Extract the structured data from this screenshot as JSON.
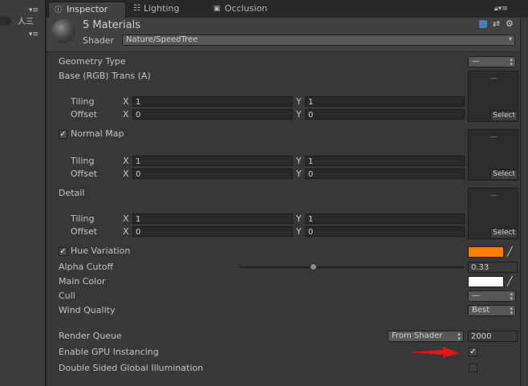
{
  "tabs": [
    {
      "label": "Inspector",
      "icon": "info-icon"
    },
    {
      "label": "Lighting",
      "icon": "lighting-icon"
    },
    {
      "label": "Occlusion",
      "icon": "occlusion-icon"
    }
  ],
  "header": {
    "title": "5 Materials",
    "shader_label": "Shader",
    "shader_value": "Nature/SpeedTree"
  },
  "properties": {
    "geometry_type": {
      "label": "Geometry Type",
      "value": "—"
    },
    "base": {
      "label": "Base (RGB) Trans (A)",
      "tiling": {
        "x": "1",
        "y": "1"
      },
      "offset": {
        "x": "0",
        "y": "0"
      }
    },
    "normal_map": {
      "label": "Normal Map",
      "checked": true,
      "tiling": {
        "x": "1",
        "y": "1"
      },
      "offset": {
        "x": "0",
        "y": "0"
      }
    },
    "detail": {
      "label": "Detail",
      "tiling": {
        "x": "1",
        "y": "1"
      },
      "offset": {
        "x": "0",
        "y": "0"
      }
    },
    "hue_variation": {
      "label": "Hue Variation",
      "checked": true,
      "color": "#ff8000"
    },
    "alpha_cutoff": {
      "label": "Alpha Cutoff",
      "value": "0.33",
      "fraction": 0.33
    },
    "main_color": {
      "label": "Main Color",
      "color": "#ffffff"
    },
    "cull": {
      "label": "Cull",
      "value": "—"
    },
    "wind_quality": {
      "label": "Wind Quality",
      "value": "Best"
    },
    "render_queue": {
      "label": "Render Queue",
      "mode": "From Shader",
      "value": "2000"
    },
    "gpu_instancing": {
      "label": "Enable GPU Instancing",
      "checked": true
    },
    "double_sided_gi": {
      "label": "Double Sided Global Illumination",
      "checked": false
    }
  },
  "common": {
    "tiling_label": "Tiling",
    "offset_label": "Offset",
    "x_label": "X",
    "y_label": "Y",
    "select_label": "Select",
    "empty_dash": "—"
  },
  "left_panel": {
    "text": "人三"
  },
  "colors": {
    "accent_arrow": "#e0161b",
    "hue_variation": "#ff8000"
  }
}
